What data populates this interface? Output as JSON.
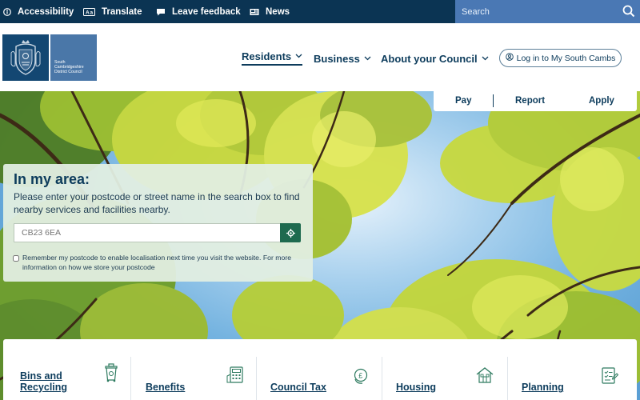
{
  "topbar": {
    "accessibility": "Accessibility",
    "translate": "Translate",
    "feedback": "Leave feedback",
    "news": "News",
    "search_placeholder": "Search"
  },
  "logo": {
    "line1": "South",
    "line2": "Cambridgeshire",
    "line3": "District Council"
  },
  "nav": {
    "residents": "Residents",
    "business": "Business",
    "about": "About your Council",
    "login": "Log in to My South Cambs"
  },
  "quick_links": {
    "pay": "Pay",
    "report": "Report",
    "apply": "Apply"
  },
  "area": {
    "title": "In my area:",
    "description": "Please enter your postcode or street name in the search box to find nearby services and facilities nearby.",
    "postcode_placeholder": "CB23 6EA",
    "remember_label": "Remember my postcode to enable localisation next time you visit the website. For more information on how we store your postcode"
  },
  "services": [
    {
      "label_line1": "Bins and",
      "label_line2": "Recycling",
      "icon": "bin-icon"
    },
    {
      "label_line1": "Benefits",
      "label_line2": "",
      "icon": "calculator-icon"
    },
    {
      "label_line1": "Council Tax",
      "label_line2": "",
      "icon": "coins-icon"
    },
    {
      "label_line1": "Housing",
      "label_line2": "",
      "icon": "house-icon"
    },
    {
      "label_line1": "Planning",
      "label_line2": "",
      "icon": "checklist-icon"
    }
  ],
  "colors": {
    "topbar": "#0b3453",
    "search": "#4a78b4",
    "navy_text": "#0d3c5c",
    "accent_green": "#1e6a4f"
  }
}
